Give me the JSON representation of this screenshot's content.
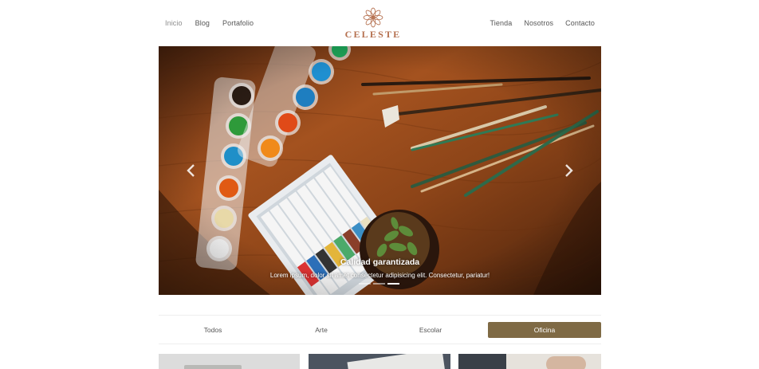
{
  "header": {
    "nav_left": [
      {
        "label": "Inicio",
        "active": true
      },
      {
        "label": "Blog",
        "active": false
      },
      {
        "label": "Portafolio",
        "active": false
      }
    ],
    "logo_text": "CELESTE",
    "logo_icon": "flower-mandala-icon",
    "nav_right": [
      {
        "label": "Tienda"
      },
      {
        "label": "Nosotros"
      },
      {
        "label": "Contacto"
      }
    ]
  },
  "carousel": {
    "caption_title": "Calidad garantizada",
    "caption_text": "Lorem ipsum, dolor sit amet consectetur adipisicing elit. Consectetur, pariatur!",
    "slide_count": 3,
    "active_slide": 3,
    "prev_icon": "chevron-left-icon",
    "next_icon": "chevron-right-icon"
  },
  "filters": [
    {
      "label": "Todos",
      "active": false
    },
    {
      "label": "Arte",
      "active": false
    },
    {
      "label": "Escolar",
      "active": false
    },
    {
      "label": "Oficina",
      "active": true
    }
  ],
  "colors": {
    "brand": "#b5704f",
    "filter_active": "#7f6a45"
  }
}
